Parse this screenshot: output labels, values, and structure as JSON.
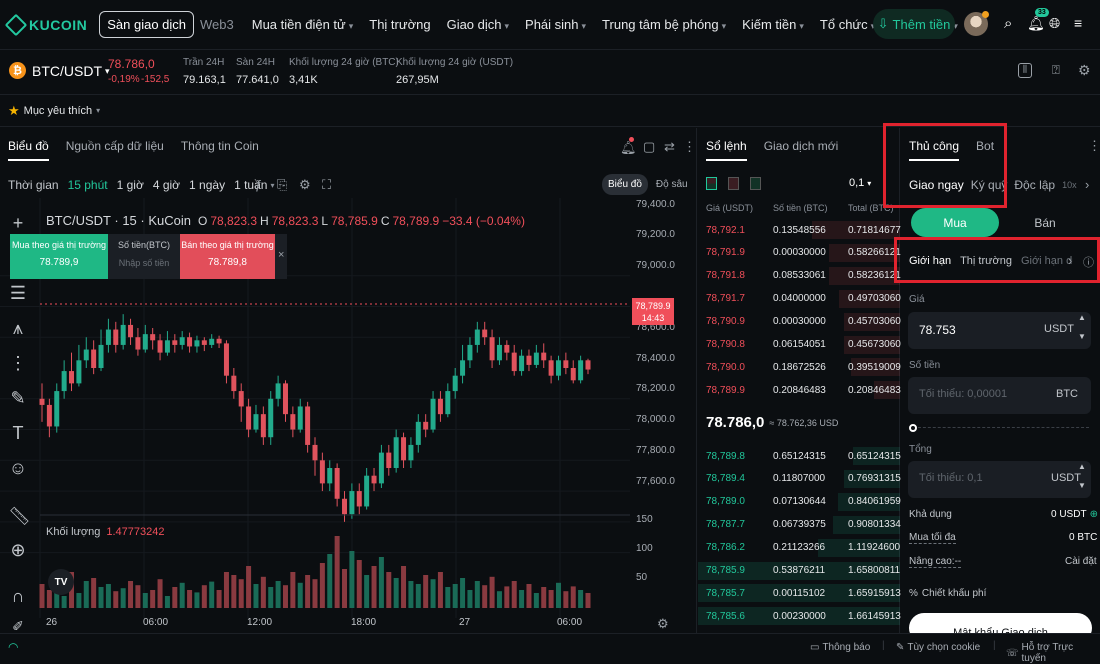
{
  "brand": "KUCOIN",
  "nav": {
    "exchange_tab": "Sàn giao dịch",
    "web3_tab": "Web3",
    "items": [
      {
        "label": "Mua tiền điện tử",
        "caret": true
      },
      {
        "label": "Thị trường",
        "caret": false
      },
      {
        "label": "Giao dịch",
        "caret": true
      },
      {
        "label": "Phái sinh",
        "caret": true
      },
      {
        "label": "Trung tâm bệ phóng",
        "caret": true
      },
      {
        "label": "Kiếm tiền",
        "caret": true
      },
      {
        "label": "Tổ chức",
        "caret": true
      },
      {
        "label": "Xem thêm",
        "caret": true
      }
    ],
    "deposit_button": "Thêm tiền",
    "notification_count": "33"
  },
  "ticker": {
    "pair": "BTC/USDT",
    "coin_symbol": "₿",
    "price": "78.786,0",
    "change_pct": "-0,19%",
    "change_abs": "-152,5",
    "stats": [
      {
        "label": "Trần 24H",
        "value": "79.163,1"
      },
      {
        "label": "Sàn 24H",
        "value": "77.641,0"
      },
      {
        "label": "Khối lượng 24 giờ (BTC)",
        "value": "3,41K"
      },
      {
        "label": "Khối lượng 24 giờ (USDT)",
        "value": "267,95M"
      }
    ]
  },
  "favorites_label": "Mục yêu thích",
  "chart_panel": {
    "tabs": [
      "Biểu đồ",
      "Nguồn cấp dữ liệu",
      "Thông tin Coin"
    ],
    "timeframes": [
      "Thời gian",
      "15 phút",
      "1 giờ",
      "4 giờ",
      "1 ngày",
      "1 tuần"
    ],
    "active_timeframe": "15 phút",
    "view_chart": "Biểu đồ",
    "view_depth": "Độ sâu",
    "legend_title": "BTC/USDT · 15 · KuCoin",
    "ohlc": {
      "o_label": "O",
      "o": "78,823.3",
      "h_label": "H",
      "h": "78,823.3",
      "l_label": "L",
      "l": "78,785.9",
      "c_label": "C",
      "c": "78,789.9",
      "change": "−33.4 (−0.04%)"
    },
    "quick_buy": {
      "label": "Mua theo giá thị trường",
      "price": "78.789,9"
    },
    "quick_amount": {
      "label": "Số tiền(BTC)",
      "placeholder": "Nhập số tiền"
    },
    "quick_sell": {
      "label": "Bán theo giá thị trường",
      "price": "78.789,8"
    },
    "volume_label": "Khối lượng",
    "volume_value": "1.47773242",
    "price_axis": [
      "79,400.0",
      "79,200.0",
      "79,000.0",
      "78,600.0",
      "78,400.0",
      "78,200.0",
      "78,000.0",
      "77,800.0",
      "77,600.0"
    ],
    "current_price_tag": "78,789.9",
    "countdown_tag": "14:43",
    "volume_axis": [
      "150",
      "100",
      "50"
    ],
    "time_axis": [
      "26",
      "06:00",
      "12:00",
      "18:00",
      "27",
      "06:00"
    ]
  },
  "chart_data": {
    "type": "candlestick",
    "title": "BTC/USDT · 15 · KuCoin",
    "ylim": [
      77500,
      79450
    ],
    "candles": [
      [
        78600,
        78560,
        78700,
        78450
      ],
      [
        78560,
        78420,
        78600,
        78350
      ],
      [
        78420,
        78650,
        78700,
        78380
      ],
      [
        78650,
        78780,
        78850,
        78600
      ],
      [
        78780,
        78700,
        78900,
        78650
      ],
      [
        78700,
        78850,
        78950,
        78680
      ],
      [
        78850,
        78920,
        79000,
        78800
      ],
      [
        78920,
        78800,
        78980,
        78760
      ],
      [
        78800,
        78950,
        79050,
        78780
      ],
      [
        78950,
        79050,
        79120,
        78900
      ],
      [
        79050,
        78950,
        79100,
        78900
      ],
      [
        78950,
        79080,
        79150,
        78920
      ],
      [
        79080,
        79000,
        79120,
        78950
      ],
      [
        79000,
        78920,
        79060,
        78880
      ],
      [
        78920,
        79020,
        79080,
        78900
      ],
      [
        79020,
        78980,
        79060,
        78920
      ],
      [
        78980,
        78900,
        79020,
        78850
      ],
      [
        78900,
        78980,
        79040,
        78880
      ],
      [
        78980,
        78950,
        79020,
        78900
      ],
      [
        78950,
        79000,
        79040,
        78920
      ],
      [
        79000,
        78940,
        79030,
        78900
      ],
      [
        78940,
        78980,
        79010,
        78900
      ],
      [
        78980,
        78950,
        79000,
        78910
      ],
      [
        78950,
        78990,
        79020,
        78930
      ],
      [
        78990,
        78960,
        79010,
        78930
      ],
      [
        78960,
        78750,
        78980,
        78700
      ],
      [
        78750,
        78650,
        78800,
        78600
      ],
      [
        78650,
        78550,
        78700,
        78450
      ],
      [
        78550,
        78400,
        78600,
        78350
      ],
      [
        78400,
        78500,
        78560,
        78380
      ],
      [
        78500,
        78350,
        78550,
        78300
      ],
      [
        78350,
        78600,
        78650,
        78300
      ],
      [
        78600,
        78700,
        78750,
        78550
      ],
      [
        78700,
        78500,
        78720,
        78450
      ],
      [
        78500,
        78400,
        78550,
        78350
      ],
      [
        78400,
        78550,
        78600,
        78380
      ],
      [
        78550,
        78300,
        78580,
        78250
      ],
      [
        78300,
        78200,
        78350,
        78100
      ],
      [
        78200,
        78050,
        78250,
        78000
      ],
      [
        78050,
        78150,
        78200,
        78000
      ],
      [
        78150,
        77950,
        78180,
        77900
      ],
      [
        77950,
        77850,
        78000,
        77800
      ],
      [
        77850,
        78000,
        78050,
        77820
      ],
      [
        78000,
        77900,
        78050,
        77850
      ],
      [
        77900,
        78100,
        78150,
        77880
      ],
      [
        78100,
        78050,
        78150,
        78000
      ],
      [
        78050,
        78250,
        78300,
        78020
      ],
      [
        78250,
        78150,
        78300,
        78100
      ],
      [
        78150,
        78350,
        78400,
        78120
      ],
      [
        78350,
        78200,
        78380,
        78150
      ],
      [
        78200,
        78300,
        78350,
        78150
      ],
      [
        78300,
        78450,
        78500,
        78250
      ],
      [
        78450,
        78400,
        78500,
        78350
      ],
      [
        78400,
        78600,
        78650,
        78380
      ],
      [
        78600,
        78500,
        78650,
        78450
      ],
      [
        78500,
        78650,
        78700,
        78480
      ],
      [
        78650,
        78750,
        78800,
        78600
      ],
      [
        78750,
        78850,
        78950,
        78700
      ],
      [
        78850,
        78950,
        79000,
        78800
      ],
      [
        78950,
        79050,
        79100,
        78900
      ],
      [
        79050,
        79000,
        79100,
        78950
      ],
      [
        79000,
        78850,
        79050,
        78800
      ],
      [
        78850,
        78950,
        79000,
        78820
      ],
      [
        78950,
        78900,
        78980,
        78850
      ],
      [
        78900,
        78780,
        78950,
        78750
      ],
      [
        78780,
        78880,
        78920,
        78750
      ],
      [
        78880,
        78820,
        78920,
        78780
      ],
      [
        78820,
        78900,
        78950,
        78800
      ],
      [
        78900,
        78850,
        78960,
        78800
      ],
      [
        78850,
        78750,
        78880,
        78700
      ],
      [
        78750,
        78850,
        78880,
        78720
      ],
      [
        78850,
        78800,
        78900,
        78760
      ],
      [
        78800,
        78720,
        78850,
        78700
      ],
      [
        78720,
        78850,
        78880,
        78700
      ],
      [
        78850,
        78790,
        78860,
        78760
      ]
    ],
    "volumes": [
      40,
      30,
      55,
      20,
      60,
      25,
      45,
      50,
      35,
      40,
      28,
      33,
      45,
      38,
      25,
      30,
      48,
      20,
      35,
      42,
      30,
      26,
      38,
      44,
      30,
      60,
      55,
      48,
      70,
      40,
      52,
      35,
      45,
      38,
      60,
      42,
      55,
      48,
      75,
      90,
      120,
      65,
      95,
      80,
      55,
      70,
      85,
      60,
      50,
      70,
      45,
      40,
      55,
      48,
      60,
      35,
      40,
      50,
      30,
      45,
      38,
      52,
      28,
      36,
      45,
      30,
      40,
      25,
      35,
      30,
      42,
      28,
      36,
      30,
      25
    ]
  },
  "orderbook": {
    "tabs": [
      "Sổ lệnh",
      "Giao dịch mới"
    ],
    "precision": "0,1",
    "headers": [
      "Giá (USDT)",
      "Số tiền (BTC)",
      "Total (BTC)"
    ],
    "asks": [
      [
        "78,792.1",
        "0.13548556",
        "0.71814677"
      ],
      [
        "78,791.9",
        "0.00030000",
        "0.58266121"
      ],
      [
        "78,791.8",
        "0.08533061",
        "0.58236121"
      ],
      [
        "78,791.7",
        "0.04000000",
        "0.49703060"
      ],
      [
        "78,790.9",
        "0.00030000",
        "0.45703060"
      ],
      [
        "78,790.8",
        "0.06154051",
        "0.45673060"
      ],
      [
        "78,790.0",
        "0.18672526",
        "0.39519009"
      ],
      [
        "78,789.9",
        "0.20846483",
        "0.20846483"
      ]
    ],
    "ask_depth": [
      0.72,
      0.58,
      0.58,
      0.5,
      0.46,
      0.46,
      0.4,
      0.21
    ],
    "mid_price": "78.786,0",
    "mid_usd": "≈ 78.762,36 USD",
    "bids": [
      [
        "78,789.8",
        "0.65124315",
        "0.65124315"
      ],
      [
        "78,789.4",
        "0.11807000",
        "0.76931315"
      ],
      [
        "78,789.0",
        "0.07130644",
        "0.84061959"
      ],
      [
        "78,787.7",
        "0.06739375",
        "0.90801334"
      ],
      [
        "78,786.2",
        "0.21123266",
        "1.11924600"
      ],
      [
        "78,785.9",
        "0.53876211",
        "1.65800811"
      ],
      [
        "78,785.7",
        "0.00115102",
        "1.65915913"
      ],
      [
        "78,785.6",
        "0.00230000",
        "1.66145913"
      ]
    ],
    "bid_depth": [
      0.39,
      0.46,
      0.51,
      0.55,
      0.67,
      1.0,
      1.0,
      1.0
    ]
  },
  "trade": {
    "mode_tabs": [
      "Thủ công",
      "Bot"
    ],
    "market_tabs": [
      "Giao ngay",
      "Ký quỹ",
      "Đòn bẩy",
      "10x",
      "Độc lập"
    ],
    "buy_label": "Mua",
    "sell_label": "Bán",
    "order_types": [
      "Giới hạn",
      "Thị trường",
      "Giới hạn dừng"
    ],
    "price_label": "Giá",
    "price_value": "78.753",
    "price_unit": "USDT",
    "amount_label": "Số tiền",
    "amount_placeholder": "Tối thiểu: 0,00001",
    "amount_unit": "BTC",
    "total_label": "Tổng",
    "total_placeholder": "Tối thiểu: 0,1",
    "total_unit": "USDT",
    "available_label": "Khả dụng",
    "available_value": "0 USDT",
    "max_buy_label": "Mua tối đa",
    "max_buy_value": "0 BTC",
    "advanced_label": "Nâng cao:--",
    "settings_label": "Cài đặt",
    "fee_label": "Chiết khấu phí",
    "unlock_button": "Mật khẩu Giao dịch"
  },
  "statusbar": {
    "notifications": "Thông báo",
    "cookies": "Tùy chọn cookie",
    "support": "Hỗ trợ Trực tuyến"
  }
}
